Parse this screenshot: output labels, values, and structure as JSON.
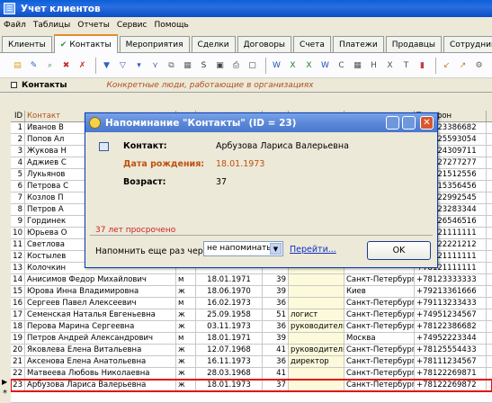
{
  "window": {
    "title": "Учет клиентов",
    "icon": "app-icon"
  },
  "menu": [
    "Файл",
    "Таблицы",
    "Отчеты",
    "Сервис",
    "Помощь"
  ],
  "tabs": [
    "Клиенты",
    "Контакты",
    "Мероприятия",
    "Сделки",
    "Договоры",
    "Счета",
    "Платежи",
    "Продавцы",
    "Сотрудники"
  ],
  "active_tab": "Контакты",
  "toolbar_icons": [
    "new-doc-icon",
    "edit-icon",
    "search-icon",
    "delete-icon",
    "delete-x-icon",
    "filter-icon",
    "filter-clear-icon",
    "filter-down-icon",
    "filter-auto-icon",
    "copy-icon",
    "options-icon",
    "sql-icon",
    "print-icon",
    "printer-icon",
    "preview-icon",
    "word-icon",
    "excel-icon",
    "excel2-icon",
    "word2-icon",
    "csv-icon",
    "table-icon",
    "html-icon",
    "xml-icon",
    "txt-icon",
    "chart-icon",
    "import-icon",
    "export-icon",
    "settings-icon"
  ],
  "panel": {
    "title": "Контакты",
    "description": "Конкретные люди, работающие в организациях"
  },
  "grid": {
    "headers": [
      "ID",
      "Контакт",
      "",
      "",
      "",
      "",
      "",
      "Телефон"
    ],
    "id_header": "ID",
    "contact_header": "Контакт",
    "phone_header": "Телефон",
    "top_rows": [
      {
        "id": "1",
        "name": "Иванов В"
      },
      {
        "id": "2",
        "name": "Попов Ал"
      },
      {
        "id": "3",
        "name": "Жукова Н"
      },
      {
        "id": "4",
        "name": "Аджиев С"
      },
      {
        "id": "5",
        "name": "Лукьянов"
      },
      {
        "id": "6",
        "name": "Петрова С"
      },
      {
        "id": "7",
        "name": "Козлов П"
      },
      {
        "id": "8",
        "name": "Петров А"
      },
      {
        "id": "9",
        "name": "Гординек"
      },
      {
        "id": "10",
        "name": "Юрьева О"
      },
      {
        "id": "11",
        "name": "Светлова"
      },
      {
        "id": "12",
        "name": "Костылев"
      },
      {
        "id": "13",
        "name": "Колочкин"
      }
    ],
    "top_phones": [
      "+78123386682",
      "+78125593054",
      "+78124309711",
      "+78127277277",
      "+78121512556",
      "+78115356456",
      "+78122992545",
      "+78123283344",
      "+78126546516",
      "+78121111111",
      "+78122221212",
      "+78121111111",
      "+78121111111"
    ],
    "rows": [
      {
        "id": "14",
        "name": "Анисимов Федор Михайлович",
        "sex": "м",
        "dob": "18.01.1971",
        "age": "39",
        "pos": "",
        "city": "Санкт-Петербург",
        "phone": "+78123333333"
      },
      {
        "id": "15",
        "name": "Юрова Инна Владимировна",
        "sex": "ж",
        "dob": "18.06.1970",
        "age": "39",
        "pos": "",
        "city": "Киев",
        "phone": "+79213361666"
      },
      {
        "id": "16",
        "name": "Сергеев Павел Алексеевич",
        "sex": "м",
        "dob": "16.02.1973",
        "age": "36",
        "pos": "",
        "city": "Санкт-Петербург",
        "phone": "+79113233433"
      },
      {
        "id": "17",
        "name": "Семенская Наталья Евгеньевна",
        "sex": "ж",
        "dob": "25.09.1958",
        "age": "51",
        "pos": "логист",
        "city": "Санкт-Петербург",
        "phone": "+74951234567"
      },
      {
        "id": "18",
        "name": "Перова Марина Сергеевна",
        "sex": "ж",
        "dob": "03.11.1973",
        "age": "36",
        "pos": "руководитель",
        "city": "Санкт-Петербург",
        "phone": "+78122386682"
      },
      {
        "id": "19",
        "name": "Петров Андрей Александрович",
        "sex": "м",
        "dob": "18.01.1971",
        "age": "39",
        "pos": "",
        "city": "Москва",
        "phone": "+74952223344"
      },
      {
        "id": "20",
        "name": "Яковлева Елена Витальевна",
        "sex": "ж",
        "dob": "12.07.1968",
        "age": "41",
        "pos": "руководитель",
        "city": "Санкт-Петербург",
        "phone": "+78125554433"
      },
      {
        "id": "21",
        "name": "Аксенова Елена Анатольевна",
        "sex": "ж",
        "dob": "16.11.1973",
        "age": "36",
        "pos": "директор",
        "city": "Санкт-Петербург",
        "phone": "+78111234567"
      },
      {
        "id": "22",
        "name": "Матвеева Любовь Николаевна",
        "sex": "ж",
        "dob": "28.03.1968",
        "age": "41",
        "pos": "",
        "city": "Санкт-Петербург",
        "phone": "+78122269871"
      },
      {
        "id": "23",
        "name": "Арбузова Лариса Валерьевна",
        "sex": "ж",
        "dob": "18.01.1973",
        "age": "37",
        "pos": "",
        "city": "Санкт-Петербург",
        "phone": "+78122269872"
      }
    ],
    "new_row_marker": "*"
  },
  "dialog": {
    "title": "Напоминание \"Контакты\" (ID = 23)",
    "contact_label": "Контакт:",
    "contact_value": "Арбузова Лариса Валерьевна",
    "dob_label": "Дата рождения:",
    "dob_value": "18.01.1973",
    "age_label": "Возраст:",
    "age_value": "37",
    "overdue": "37 лет просрочено",
    "remind_label": "Напомнить еще раз через:",
    "remind_value": "не напоминать",
    "goto_link": "Перейти...",
    "ok": "OK",
    "label_color": "#c05010",
    "value_color": "#c05010"
  }
}
